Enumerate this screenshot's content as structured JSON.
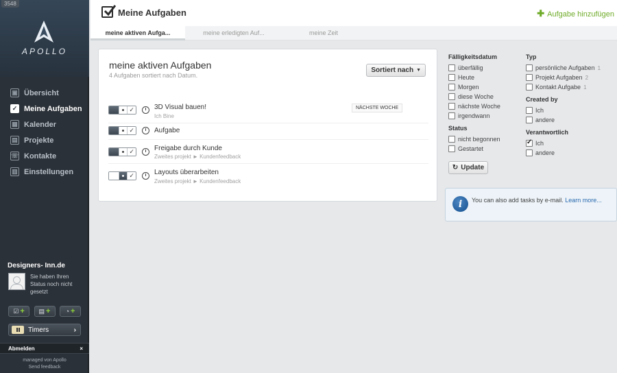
{
  "sidebar": {
    "counter": "3548",
    "logo_text": "APOLLO",
    "nav": [
      {
        "label": "Übersicht",
        "icon": "overview-icon"
      },
      {
        "label": "Meine Aufgaben",
        "icon": "checkbox-icon",
        "active": true
      },
      {
        "label": "Kalender",
        "icon": "calendar-icon"
      },
      {
        "label": "Projekte",
        "icon": "projects-icon"
      },
      {
        "label": "Kontakte",
        "icon": "contacts-icon"
      },
      {
        "label": "Einstellungen",
        "icon": "settings-icon"
      }
    ],
    "profile": {
      "name": "Designers- Inn.de",
      "status": "Sie haben Ihren Status noch nicht gesetzt"
    },
    "quick_buttons": [
      "add-task",
      "add-note",
      "add-time"
    ],
    "timers_label": "Timers",
    "logout_label": "Abmelden",
    "footer": [
      "managed von Apollo",
      "Send feedback"
    ]
  },
  "header": {
    "title": "Meine Aufgaben",
    "add_task_label": "Aufgabe hinzufügen"
  },
  "tabs": [
    {
      "label": "meine aktiven Aufga...",
      "active": true
    },
    {
      "label": "meine erledigten Auf..."
    },
    {
      "label": "meine Zeit"
    }
  ],
  "main": {
    "title": "meine aktiven Aufgaben",
    "subtitle": "4 Aufgaben sortiert nach Datum.",
    "sort_label": "Sortiert nach",
    "tasks": [
      {
        "title": "3D Visual bauen!",
        "meta": "Ich Bine",
        "badge": "NÄCHSTE WOCHE"
      },
      {
        "title": "Aufgabe",
        "meta": "",
        "badge": ""
      },
      {
        "title": "Freigabe durch Kunde",
        "meta": "Zweites projekt ► Kundenfeedback",
        "badge": ""
      },
      {
        "title": "Layouts überarbeiten",
        "meta": "Zweites projekt ► Kundenfeedback",
        "badge": ""
      }
    ]
  },
  "filters": {
    "due_heading": "Fälligkeitsdatum",
    "due": [
      "überfällig",
      "Heute",
      "Morgen",
      "diese Woche",
      "nächste Woche",
      "irgendwann"
    ],
    "status_heading": "Status",
    "status": [
      "nicht begonnen",
      "Gestartet"
    ],
    "type_heading": "Typ",
    "types": [
      {
        "label": "persönliche Aufgaben",
        "count": "1"
      },
      {
        "label": "Projekt Aufgaben",
        "count": "2"
      },
      {
        "label": "Kontakt Aufgabe",
        "count": "1"
      }
    ],
    "created_heading": "Created by",
    "created": [
      {
        "label": "Ich",
        "checked": false
      },
      {
        "label": "andere",
        "checked": false
      }
    ],
    "responsible_heading": "Verantwortlich",
    "responsible": [
      {
        "label": "Ich",
        "checked": true
      },
      {
        "label": "andere",
        "checked": false
      }
    ],
    "update_label": "Update"
  },
  "info": {
    "text": "You can also add tasks by e-mail.",
    "link": "Learn more..."
  },
  "colors": {
    "sidebar_bg": "#2b3138",
    "accent_green": "#6fab29",
    "link_blue": "#2a6ab0"
  }
}
